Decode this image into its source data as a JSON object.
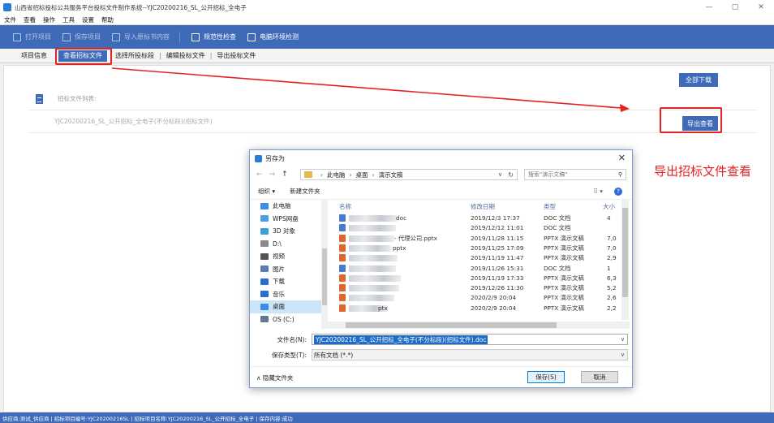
{
  "window": {
    "title": "山西省招标投标公共服务平台投标文件制作系统--YJC20200216_SL_公开招标_全电子",
    "controls": [
      "—",
      "▢",
      "✕"
    ]
  },
  "menu": [
    "文件",
    "查看",
    "操作",
    "工具",
    "设置",
    "帮助"
  ],
  "toolbar": {
    "open_project": "打开项目",
    "save_project": "保存项目",
    "import_content": "导入原标书内容",
    "standard_check": "规范性检查",
    "env_check": "电脑环境检测"
  },
  "tabs": {
    "project_info": "项目信息",
    "view_tender": "查看招标文件",
    "select_section": "选择所投标段",
    "edit_bid": "编辑投标文件",
    "export_bid": "导出投标文件",
    "separator": "|"
  },
  "main": {
    "download_all": "全部下载",
    "list_label": "招标文件列表:",
    "file_name": "YJC20200216_SL_公开招标_全电子(不分标段)(招标文件)",
    "export_view": "导出查看"
  },
  "annotation": "导出招标文件查看",
  "status": "供应商:测试_供应商 | 招标项目编号:YJC20200216SL | 招标项目名称:YJC20200216_SL_公开招标_全电子 | 保存内容:成功",
  "dialog": {
    "title": "另存为",
    "close": "✕",
    "nav": {
      "back": "←",
      "forward": "→",
      "up": "↑"
    },
    "breadcrumb": [
      "此电脑",
      "桌面",
      "演示文稿"
    ],
    "search_placeholder": "搜索\"演示文稿\"",
    "organize": "组织 ▾",
    "new_folder": "新建文件夹",
    "view_options": "⠿ ▾",
    "help": "?",
    "tree": [
      {
        "label": "此电脑",
        "color": "#3a8ee6"
      },
      {
        "label": "WPS网盘",
        "color": "#4aa0e6"
      },
      {
        "label": "3D 对象",
        "color": "#3aa0d8"
      },
      {
        "label": "D:\\",
        "color": "#8a8a8a"
      },
      {
        "label": "视频",
        "color": "#555555"
      },
      {
        "label": "图片",
        "color": "#5a7ab0"
      },
      {
        "label": "下载",
        "color": "#2a6bd8"
      },
      {
        "label": "音乐",
        "color": "#2a6bd8"
      },
      {
        "label": "桌面",
        "color": "#3a8ee6",
        "selected": true
      },
      {
        "label": "OS (C:)",
        "color": "#607890"
      }
    ],
    "columns": {
      "name": "名称",
      "date": "修改日期",
      "type": "类型",
      "size": "大小"
    },
    "files": [
      {
        "suffix": "doc",
        "date": "2019/12/3 17:37",
        "type": "DOC 文档",
        "size": "4",
        "icon": "#4a7ad0"
      },
      {
        "suffix": "",
        "date": "2019/12/12 11:01",
        "type": "DOC 文档",
        "size": "",
        "icon": "#4a7ad0"
      },
      {
        "suffix": "- 代理公司.pptx",
        "date": "2019/11/28 11:15",
        "type": "PPTX 演示文稿",
        "size": "7,0",
        "icon": "#e0662c"
      },
      {
        "suffix": "pptx",
        "date": "2019/11/25 17:09",
        "type": "PPTX 演示文稿",
        "size": "7,0",
        "icon": "#e0662c"
      },
      {
        "suffix": "",
        "date": "2019/11/19 11:47",
        "type": "PPTX 演示文稿",
        "size": "2,9",
        "icon": "#e0662c"
      },
      {
        "suffix": "",
        "date": "2019/11/26 15:31",
        "type": "DOC 文档",
        "size": "1",
        "icon": "#4a7ad0"
      },
      {
        "suffix": "",
        "date": "2019/11/19 17:33",
        "type": "PPTX 演示文稿",
        "size": "6,3",
        "icon": "#e0662c"
      },
      {
        "suffix": "",
        "date": "2019/12/26 11:30",
        "type": "PPTX 演示文稿",
        "size": "5,2",
        "icon": "#e0662c"
      },
      {
        "suffix": "",
        "date": "2020/2/9 20:04",
        "type": "PPTX 演示文稿",
        "size": "2,6",
        "icon": "#e0662c"
      },
      {
        "suffix": "ptx",
        "date": "2020/2/9 20:04",
        "type": "PPTX 演示文稿",
        "size": "2,2",
        "icon": "#e0662c"
      }
    ],
    "filename_label": "文件名(N):",
    "filename_value": "YJC20200216_SL_公开招标_全电子(不分标段)(招标文件).doc",
    "filetype_label": "保存类型(T):",
    "filetype_value": "所有文档 (*.*)",
    "hide_folders": "∧ 隐藏文件夹",
    "save": "保存(S)",
    "cancel": "取消"
  },
  "colors": {
    "accent": "#3e6ab8",
    "highlight": "#e52222",
    "selection": "#1e6cc8"
  }
}
